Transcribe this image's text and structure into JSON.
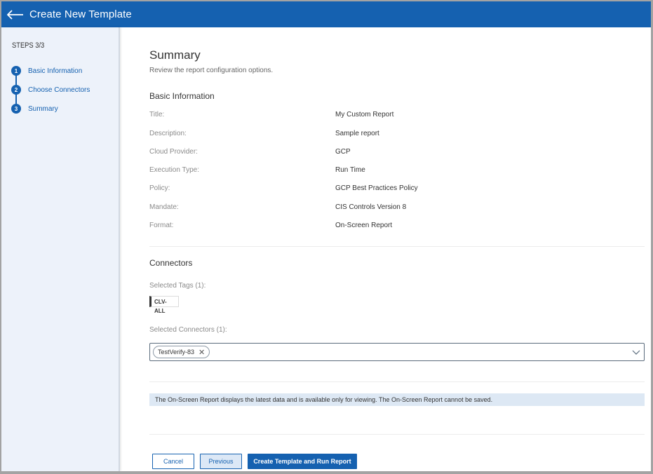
{
  "header": {
    "title": "Create New Template",
    "back_icon": "arrow-left-icon"
  },
  "sidebar": {
    "steps_label": "STEPS 3/3",
    "steps": [
      {
        "number": "1",
        "label": "Basic Information"
      },
      {
        "number": "2",
        "label": "Choose Connectors"
      },
      {
        "number": "3",
        "label": "Summary"
      }
    ]
  },
  "main": {
    "title": "Summary",
    "subtitle": "Review the report configuration options.",
    "basic_info": {
      "heading": "Basic Information",
      "rows": [
        {
          "label": "Title:",
          "value": "My Custom Report"
        },
        {
          "label": "Description:",
          "value": "Sample report"
        },
        {
          "label": "Cloud Provider:",
          "value": "GCP"
        },
        {
          "label": "Execution Type:",
          "value": "Run Time"
        },
        {
          "label": "Policy:",
          "value": "GCP Best Practices Policy"
        },
        {
          "label": "Mandate:",
          "value": "CIS Controls Version 8"
        },
        {
          "label": "Format:",
          "value": "On-Screen Report"
        }
      ]
    },
    "connectors": {
      "heading": "Connectors",
      "selected_tags_label": "Selected Tags (1):",
      "tag_line1": "CLV-",
      "tag_line2": "ALL",
      "selected_connectors_label": "Selected Connectors (1):",
      "connector_chip": "TestVerify-83",
      "chip_remove": "✕"
    },
    "notice": "The On-Screen Report displays the latest data and is available only for viewing. The On-Screen Report cannot be saved."
  },
  "footer": {
    "cancel": "Cancel",
    "previous": "Previous",
    "submit": "Create Template and Run Report"
  },
  "colors": {
    "primary": "#1561b0",
    "sidebar_bg": "#edf2fa",
    "notice_bg": "#dde8f4"
  }
}
